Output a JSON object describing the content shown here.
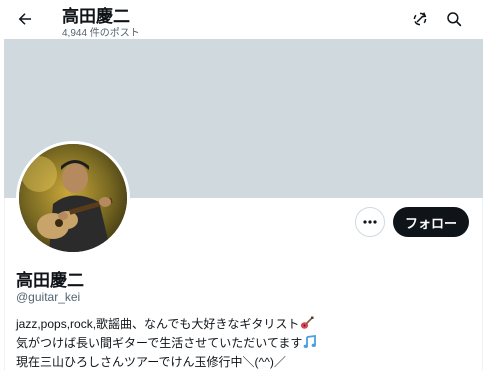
{
  "header": {
    "title": "高田慶二",
    "post_count": "4,944 件のポスト"
  },
  "profile": {
    "display_name": "高田慶二",
    "handle": "@guitar_kei",
    "follow_label": "フォロー",
    "bio_lines": [
      "jazz,pops,rock,歌謡曲、なんでも大好きなギタリスト",
      "気がつけば長い間ギターで生活させていただいてます",
      "現在三山ひろしさんツアーでけん玉修行中＼(^^)／"
    ]
  },
  "icons": {
    "back": "arrow-left-icon",
    "refresh": "refresh-icon",
    "search": "search-icon",
    "more": "more-horizontal-icon",
    "guitar": "guitar-emoji-icon",
    "music": "music-notes-emoji-icon"
  },
  "colors": {
    "banner": "#cfd9de",
    "text_primary": "#0f1419",
    "text_secondary": "#536471",
    "follow_button": "#0f1419"
  }
}
